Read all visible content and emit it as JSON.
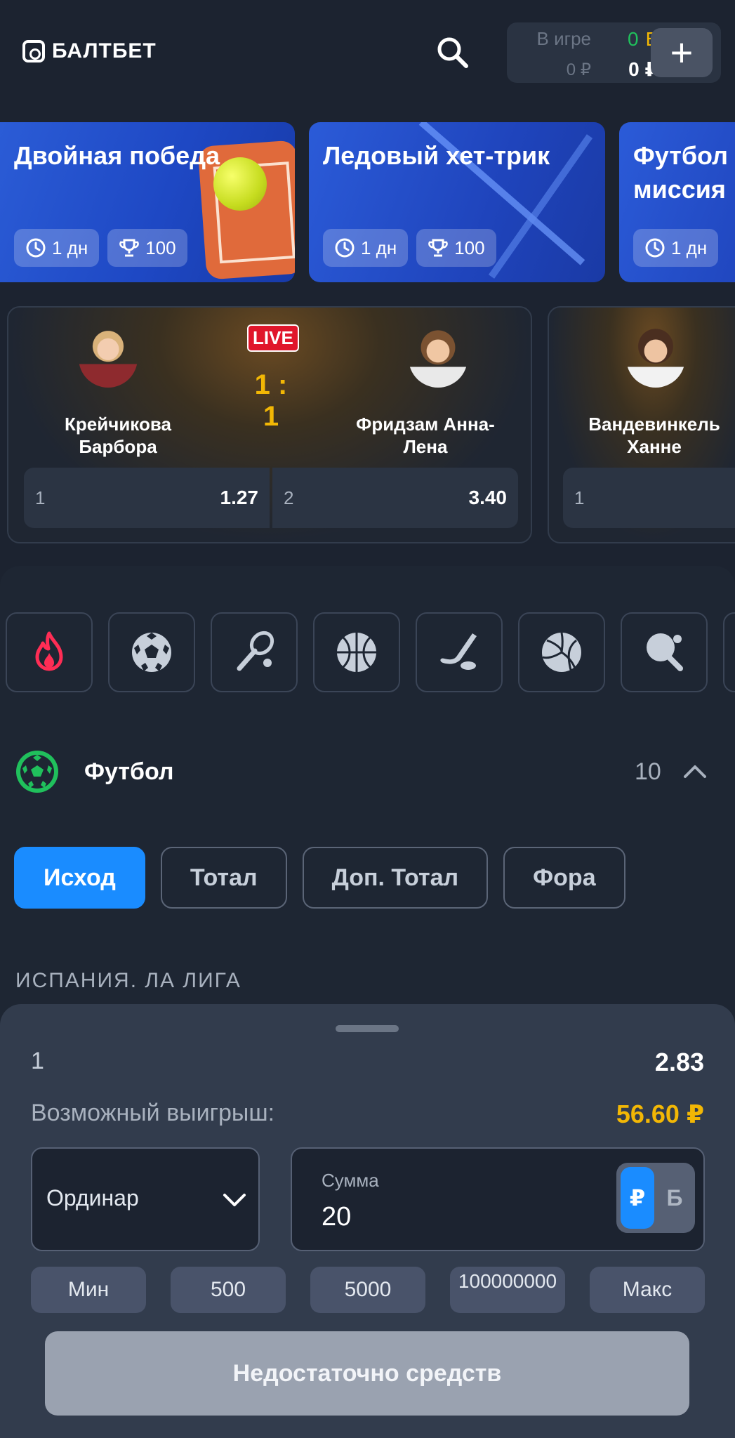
{
  "header": {
    "brand": "БАЛТБЕТ",
    "balance": {
      "in_game_label": "В игре",
      "in_game_value": "0 ₽",
      "bonus_label_green": "0",
      "bonus_label_yellow": "Б",
      "main_value": "0 ₽",
      "add_label": "+"
    }
  },
  "promos": [
    {
      "title": "Двойная победа",
      "duration": "1 дн",
      "prize": "100"
    },
    {
      "title": "Ледовый хет-трик",
      "duration": "1 дн",
      "prize": "100"
    },
    {
      "title": "Футбол миссия",
      "duration": "1 дн"
    }
  ],
  "matches": [
    {
      "live_badge": "LIVE",
      "score": "1 : 1",
      "player1": "Крейчикова Барбора",
      "player2": "Фридзам Анна-Лена",
      "odds": [
        {
          "label": "1",
          "value": "1.27"
        },
        {
          "label": "2",
          "value": "3.40"
        }
      ]
    },
    {
      "player1": "Вандевинкель Ханне",
      "odds": [
        {
          "label": "1",
          "value": ""
        }
      ]
    }
  ],
  "sports": [
    "fire-icon",
    "soccer-ball-icon",
    "tennis-icon",
    "basketball-icon",
    "hockey-icon",
    "volleyball-icon",
    "table-tennis-icon"
  ],
  "section": {
    "title": "Футбол",
    "count": "10"
  },
  "filters": [
    "Исход",
    "Тотал",
    "Доп. Тотал",
    "Фора"
  ],
  "league": "ИСПАНИЯ. ЛА ЛИГА",
  "slip": {
    "selection": "1",
    "selection_odd": "2.83",
    "win_label": "Возможный выигрыш:",
    "win_value": "56.60 ₽",
    "bet_type": "Ординар",
    "amount_caption": "Сумма",
    "amount_value": "20",
    "currency_rub": "₽",
    "currency_bonus": "Б",
    "quick": [
      "Мин",
      "500",
      "5000",
      "100000000",
      "Макс"
    ],
    "submit": "Недостаточно средств"
  },
  "colors": {
    "accent": "#1a8cff",
    "gold": "#f2b705",
    "live": "#e0162b",
    "green": "#20c05c"
  }
}
